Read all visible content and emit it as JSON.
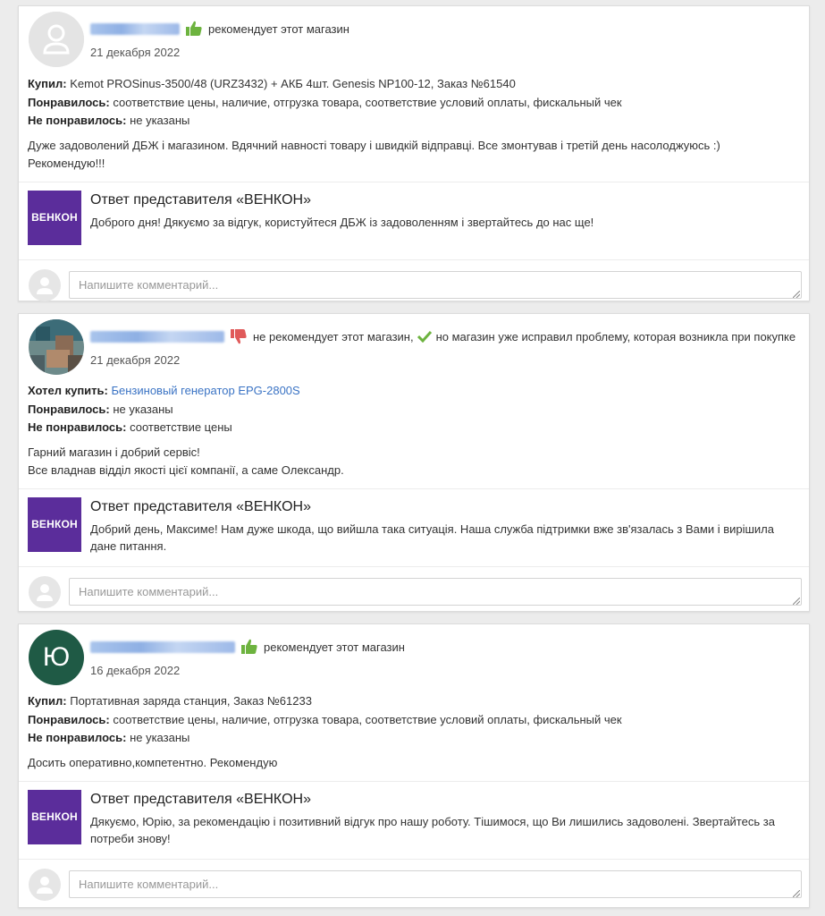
{
  "reviews": [
    {
      "author": "Олег Литвін",
      "verdict": "рекомендует этот магазин",
      "date": "21 декабря 2022",
      "line1_label": "Купил:",
      "line1_value": "Kemot PROSinus-3500/48 (URZ3432) + АКБ 4шт. Genesis NP100-12, Заказ №61540",
      "liked_label": "Понравилось:",
      "liked_value": "соответствие цены, наличие, отгрузка товара, соответствие условий оплаты, фискальный чек",
      "disliked_label": "Не понравилось:",
      "disliked_value": "не указаны",
      "text_1": "Дуже задоволений ДБЖ і магазином. Вдячний навності товару і швидкій відправці. Все змонтував і третій день насолоджуюсь :)",
      "text_2": "Рекомендую!!!",
      "reply_title": "Ответ представителя «ВЕНКОН»",
      "reply_text": "Доброго дня! Дякуємо за відгук, користуйтеся ДБЖ із задоволенням і звертайтесь до нас ще!"
    },
    {
      "author": "Максим Мельниченко",
      "verdict": "не рекомендует этот магазин,",
      "verdict_fixed": "но магазин уже исправил проблему, которая возникла при покупке",
      "date": "21 декабря 2022",
      "line1_label": "Хотел купить:",
      "line1_link": "Бензиновый генератор  EPG-2800S",
      "liked_label": "Понравилось:",
      "liked_value": "не указаны",
      "disliked_label": "Не понравилось:",
      "disliked_value": "соответствие цены",
      "text_1": "Гарний магазин і добрий сервіс!",
      "text_2": "Все владнав відділ якості цієї компанії, а саме Олександр.",
      "reply_title": "Ответ представителя «ВЕНКОН»",
      "reply_text": "Добрий день, Максиме! Нам дуже шкода, що вийшла така ситуація. Наша служба підтримки вже зв'язалась з Вами і вирішила дане питання."
    },
    {
      "author": "Юрий Рукавишников",
      "avatar_letter": "Ю",
      "verdict": "рекомендует этот магазин",
      "date": "16 декабря 2022",
      "line1_label": "Купил:",
      "line1_value": "Портативная заряда станция, Заказ №61233",
      "liked_label": "Понравилось:",
      "liked_value": "соответствие цены, наличие, отгрузка товара, соответствие условий оплаты, фискальный чек",
      "disliked_label": "Не понравилось:",
      "disliked_value": "не указаны",
      "text_1": "Досить оперативно,компетентно. Рекомендую",
      "reply_title": "Ответ представителя «ВЕНКОН»",
      "reply_text": "Дякуємо, Юрію, за рекомендацію і позитивний відгук про нашу роботу. Тішимося, що Ви лишились задоволені. Звертайтесь за потреби знову!"
    }
  ],
  "logo_text": "ВЕНКОН",
  "comment_placeholder": "Напишите комментарий...",
  "colors": {
    "logo_bg": "#5b2d9b",
    "thumb_up": "#6db33f",
    "thumb_down": "#e05a5a",
    "link": "#3a73c4"
  }
}
